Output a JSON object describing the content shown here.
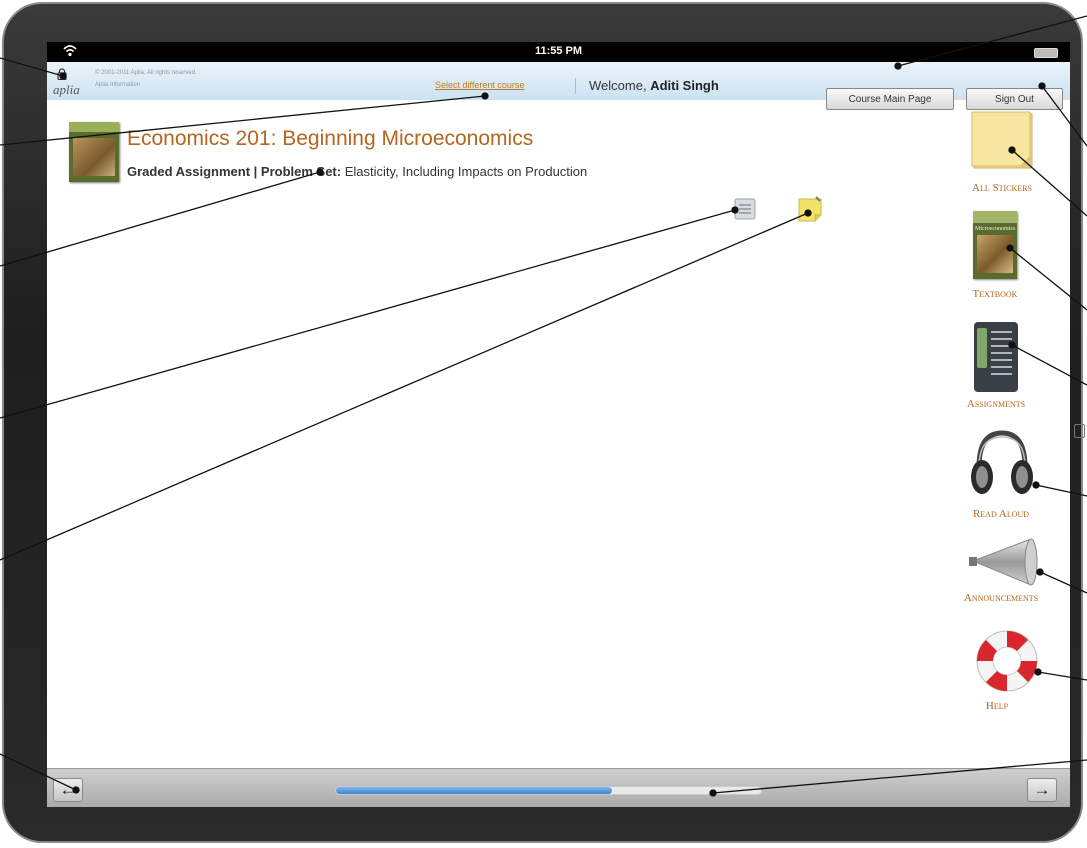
{
  "status_bar": {
    "time": "11:55 PM"
  },
  "header": {
    "logo": "aplia",
    "copyright": "© 2001-2011 Aplia. All rights reserved.",
    "legal": "Aplia Information",
    "select_course": "Select different course",
    "welcome_prefix": "Welcome,",
    "user_name": "Aditi Singh",
    "course_main_button": "Course Main Page",
    "sign_out_button": "Sign Out"
  },
  "course": {
    "title": "Economics 201: Beginning Microeconomics",
    "assignment_type": "Graded Assignment | Problem Set:",
    "assignment_name": "Elasticity, Including Impacts on Production"
  },
  "toolbar": {
    "notes_icon": "notes-icon",
    "sticky_icon": "sticky-note-icon"
  },
  "sidebar": {
    "items": [
      {
        "label": "All Stickers",
        "icon": "sticky-notes-icon"
      },
      {
        "label": "Textbook",
        "icon": "textbook-icon",
        "cover_text": "Microeconomics"
      },
      {
        "label": "Assignments",
        "icon": "assignments-icon"
      },
      {
        "label": "Read Aloud",
        "icon": "headphones-icon"
      },
      {
        "label": "Announcements",
        "icon": "megaphone-icon"
      },
      {
        "label": "Help",
        "icon": "life-ring-icon"
      }
    ]
  },
  "bottom_bar": {
    "prev_glyph": "←",
    "next_glyph": "→",
    "progress": 0.65
  },
  "colors": {
    "accent": "#b5651d",
    "progress": "#3a84d1"
  }
}
